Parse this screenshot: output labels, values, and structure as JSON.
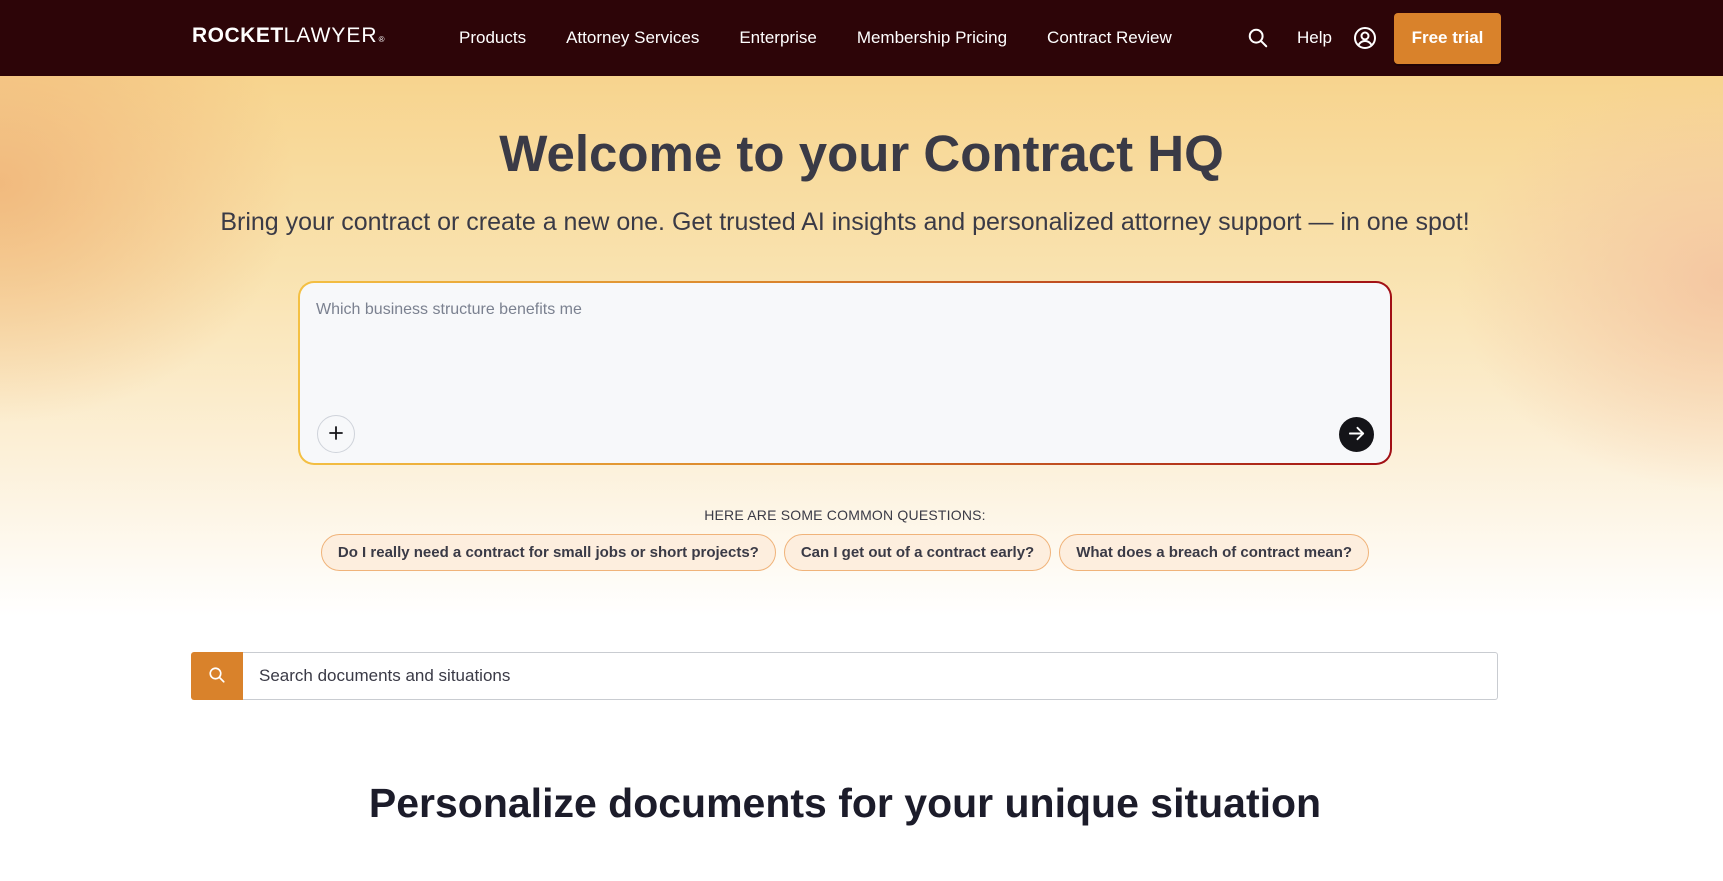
{
  "header": {
    "logo_strong": "ROCKET",
    "logo_light": "LAWYER",
    "logo_mark": "®",
    "nav": [
      {
        "label": "Products"
      },
      {
        "label": "Attorney Services"
      },
      {
        "label": "Enterprise"
      },
      {
        "label": "Membership Pricing"
      },
      {
        "label": "Contract Review"
      }
    ],
    "search_icon": "search-icon",
    "help_label": "Help",
    "account_icon": "user-circle-icon",
    "cta_label": "Free trial"
  },
  "hero": {
    "title": "Welcome to your Contract HQ",
    "subtitle": "Bring your contract or create a new one. Get trusted AI insights and personalized attorney support — in one spot!",
    "prompt": {
      "placeholder": "Which business structure benefits me",
      "value": "",
      "attach_icon": "plus-icon",
      "send_icon": "arrow-right-icon"
    },
    "common_label": "HERE ARE SOME COMMON QUESTIONS:",
    "questions": [
      {
        "label": "Do I really need a contract for small jobs or short projects?"
      },
      {
        "label": "Can I get out of a contract early?"
      },
      {
        "label": "What does a breach of contract mean?"
      }
    ]
  },
  "doc_search": {
    "placeholder": "Search documents and situations",
    "icon": "search-icon"
  },
  "section": {
    "title": "Personalize documents for your unique situation"
  },
  "colors": {
    "header_bg": "#2d0508",
    "accent": "#d9822b",
    "text": "#3a3a46"
  }
}
